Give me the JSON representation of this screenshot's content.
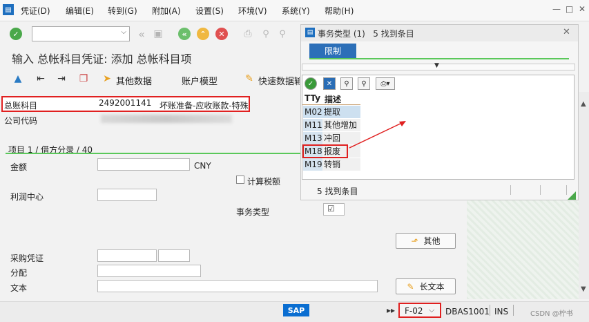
{
  "menu": {
    "items": [
      "凭证(D)",
      "编辑(E)",
      "转到(G)",
      "附加(A)",
      "设置(S)",
      "环境(V)",
      "系统(Y)",
      "帮助(H)"
    ],
    "window_controls": [
      "—",
      "□",
      "✕"
    ]
  },
  "toolbar": {
    "command_value": "",
    "title": "输入 总帐科目凭证: 添加 总帐科目项"
  },
  "toolbar2": {
    "other_data": "其他数据",
    "account_model": "账户模型",
    "fast_entry": "快速数据输"
  },
  "form": {
    "gl_label": "总账科目",
    "gl_value": "2492001141",
    "gl_desc": "坏账准备-应收账款-特殊",
    "company_label": "公司代码",
    "section_title": "项目 1 / 借方分录 / 40",
    "amount_label": "金额",
    "currency": "CNY",
    "calc_tax": "计算税额",
    "profit_center": "利润中心",
    "trans_type": "事务类型",
    "trans_type_value": "☑",
    "other_btn": "其他",
    "po_label": "采购凭证",
    "assign_label": "分配",
    "text_label": "文本",
    "longtext_btn": "长文本"
  },
  "popup": {
    "title": "事务类型 (1)   5 找到条目",
    "tab": "限制",
    "col_key": "TTy",
    "col_desc": "描述",
    "rows": [
      {
        "key": "M02",
        "desc": "提取"
      },
      {
        "key": "M11",
        "desc": "其他增加"
      },
      {
        "key": "M13",
        "desc": "冲回"
      },
      {
        "key": "M18",
        "desc": "报废"
      },
      {
        "key": "M19",
        "desc": "转销"
      }
    ],
    "status": "5 找到条目"
  },
  "status": {
    "logo": "SAP",
    "tcode": "F-02",
    "system": "DBAS1001",
    "mode": "INS",
    "watermark": "CSDN @柠书"
  },
  "colors": {
    "accent_green": "#5ac85a",
    "highlight_red": "#e02020",
    "tab_blue": "#2c6fb8"
  }
}
